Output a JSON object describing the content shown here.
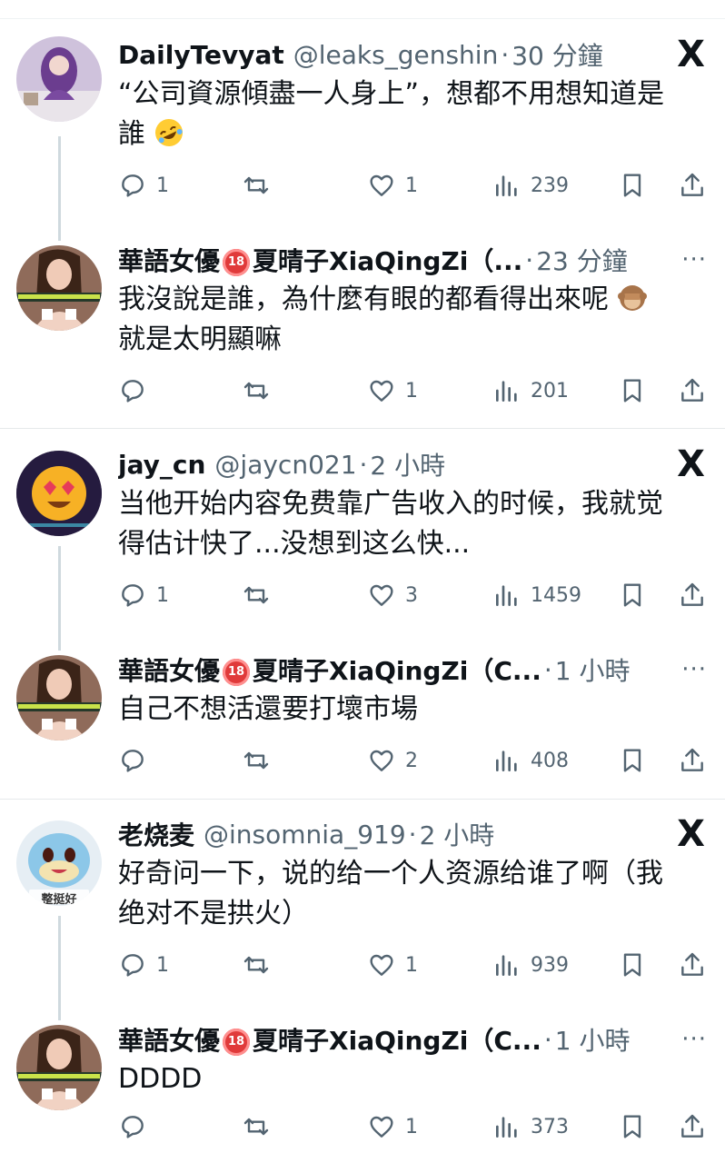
{
  "tweets": [
    {
      "name": "DailyTevyat",
      "badge": "",
      "name2": "",
      "handle": "@leaks_genshin",
      "time": "30 分鐘",
      "text1": "“公司資源傾盡一人身上”，想都不用想知道是",
      "text2": "誰",
      "emoji": "rolling-on-floor-laughing",
      "corner": "X",
      "replies": "1",
      "reposts": "",
      "likes": "1",
      "views": "239"
    },
    {
      "name": "華語女優",
      "badge": "18",
      "name2": "夏晴子XiaQingZi（...",
      "handle": "",
      "time": "23 分鐘",
      "text1": "我沒說是誰，為什麼有眼的都看得出來呢",
      "text2": "就是太明顯嘛",
      "emoji": "see-no-evil-monkey",
      "corner": "···",
      "replies": "",
      "reposts": "",
      "likes": "1",
      "views": "201"
    },
    {
      "name": "jay_cn",
      "badge": "",
      "name2": "",
      "handle": "@jaycn021",
      "time": "2 小時",
      "text1": "当他开始内容免费靠广告收入的时候，我就觉",
      "text2": "得估计快了...没想到这么快...",
      "emoji": "",
      "corner": "X",
      "replies": "1",
      "reposts": "",
      "likes": "3",
      "views": "1459"
    },
    {
      "name": "華語女優",
      "badge": "18",
      "name2": "夏晴子XiaQingZi（C...",
      "handle": "",
      "time": "1 小時",
      "text1": "自己不想活還要打壞市場",
      "text2": "",
      "emoji": "",
      "corner": "···",
      "replies": "",
      "reposts": "",
      "likes": "2",
      "views": "408"
    },
    {
      "name": "老烧麦",
      "badge": "",
      "name2": "",
      "handle": "@insomnia_919",
      "time": "2 小時",
      "text1": "好奇问一下，说的给一个人资源给谁了啊（我",
      "text2": "绝对不是拱火）",
      "emoji": "",
      "corner": "X",
      "avatar_caption": "整挺好",
      "replies": "1",
      "reposts": "",
      "likes": "1",
      "views": "939"
    },
    {
      "name": "華語女優",
      "badge": "18",
      "name2": "夏晴子XiaQingZi（C...",
      "handle": "",
      "time": "1 小時",
      "text1": "DDDD",
      "text2": "",
      "emoji": "",
      "corner": "···",
      "replies": "",
      "reposts": "",
      "likes": "1",
      "views": "373"
    }
  ],
  "separator": "·",
  "colors": {
    "text": "#0f1419",
    "secondary": "#536471",
    "divider": "#eff3f4",
    "badge": "#e03a3a"
  },
  "icons": [
    "reply-icon",
    "repost-icon",
    "like-icon",
    "views-icon",
    "bookmark-icon",
    "share-icon",
    "x-logo-icon",
    "more-icon"
  ]
}
